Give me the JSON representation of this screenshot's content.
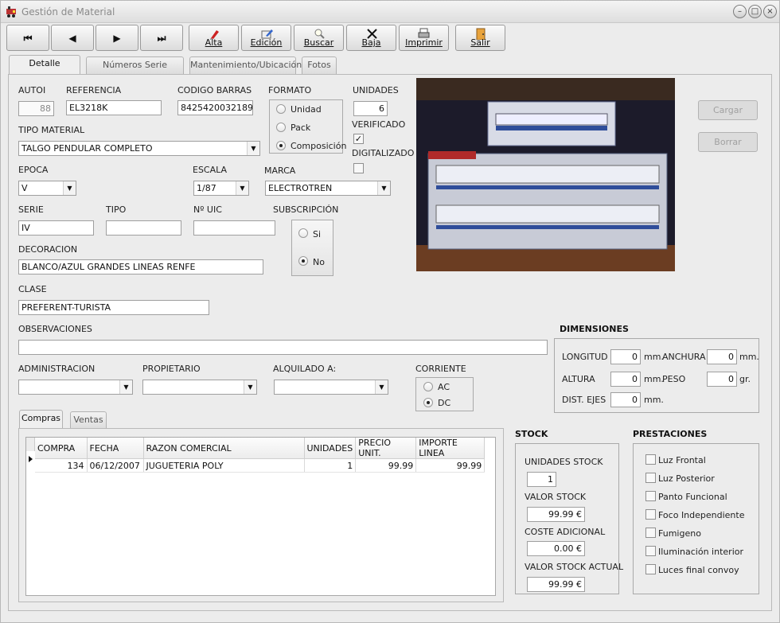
{
  "window": {
    "title": "Gestión de Material",
    "controls": [
      "–",
      "□",
      "×"
    ]
  },
  "toolbar": {
    "nav": [
      "first-record",
      "previous-record",
      "next-record",
      "last-record"
    ],
    "nav_glyphs": [
      "⏮",
      "◀",
      "▶",
      "⏭"
    ],
    "alta": "Alta",
    "edicion": "Edición",
    "buscar": "Buscar",
    "baja": "Baja",
    "imprimir": "Imprimir",
    "salir": "Salir"
  },
  "tabs": [
    "Detalle material",
    "Números Serie Material",
    "Mantenimiento/Ubicación",
    "Fotos"
  ],
  "form": {
    "autoi_label": "AUTOI",
    "autoi": "88",
    "referencia_label": "REFERENCIA",
    "referencia": "EL3218K",
    "codigo_barras_label": "CODIGO BARRAS",
    "codigo_barras": "8425420032189",
    "formato_label": "FORMATO",
    "formato_options": [
      "Unidad",
      "Pack",
      "Composición"
    ],
    "unidades_label": "UNIDADES",
    "unidades": "6",
    "verificado_label": "VERIFICADO",
    "digitalizado_label": "DIGITALIZADO",
    "tipo_material_label": "TIPO MATERIAL",
    "tipo_material": "TALGO PENDULAR COMPLETO",
    "epoca_label": "EPOCA",
    "epoca": "V",
    "escala_label": "ESCALA",
    "escala": "1/87",
    "marca_label": "MARCA",
    "marca": "ELECTROTREN",
    "serie_label": "SERIE",
    "serie": "IV",
    "tipo_label": "TIPO",
    "tipo": "",
    "nuic_label": "Nº UIC",
    "nuic": "",
    "subscripcion_label": "SUBSCRIPCIÓN",
    "subscripcion_options": [
      "Si",
      "No"
    ],
    "decoracion_label": "DECORACION",
    "decoracion": "BLANCO/AZUL GRANDES LINEAS RENFE",
    "clase_label": "CLASE",
    "clase": "PREFERENT-TURISTA",
    "observaciones_label": "OBSERVACIONES",
    "observaciones": "",
    "administracion_label": "ADMINISTRACION",
    "propietario_label": "PROPIETARIO",
    "alquilado_label": "ALQUILADO A:",
    "corriente_label": "CORRIENTE",
    "corriente_options": [
      "AC",
      "DC"
    ]
  },
  "photo_buttons": {
    "cargar": "Cargar",
    "borrar": "Borrar"
  },
  "dimensiones": {
    "title": "DIMENSIONES",
    "longitud_label": "LONGITUD",
    "longitud": "0",
    "unit_mm": "mm.",
    "anchura_label": "ANCHURA",
    "anchura": "0",
    "altura_label": "ALTURA",
    "altura": "0",
    "peso_label": "PESO",
    "peso": "0",
    "unit_gr": "gr.",
    "dist_ejes_label": "DIST. EJES",
    "dist_ejes": "0"
  },
  "subtabs": [
    "Compras",
    "Ventas"
  ],
  "grid": {
    "headers": [
      "COMPRA",
      "FECHA",
      "RAZON COMERCIAL",
      "UNIDADES",
      "PRECIO UNIT.",
      "IMPORTE LINEA"
    ],
    "rows": [
      [
        "134",
        "06/12/2007",
        "JUGUETERIA POLY",
        "1",
        "99.99",
        "99.99"
      ]
    ]
  },
  "stock": {
    "title": "STOCK",
    "unidades_label": "UNIDADES STOCK",
    "unidades": "1",
    "valor_label": "VALOR STOCK",
    "valor": "99.99 €",
    "coste_label": "COSTE ADICIONAL",
    "coste": "0.00 €",
    "actual_label": "VALOR STOCK ACTUAL",
    "actual": "99.99 €"
  },
  "prestaciones": {
    "title": "PRESTACIONES",
    "items": [
      "Luz Frontal",
      "Luz Posterior",
      "Panto Funcional",
      "Foco Independiente",
      "Fumigeno",
      "Iluminación interior",
      "Luces final convoy"
    ]
  }
}
